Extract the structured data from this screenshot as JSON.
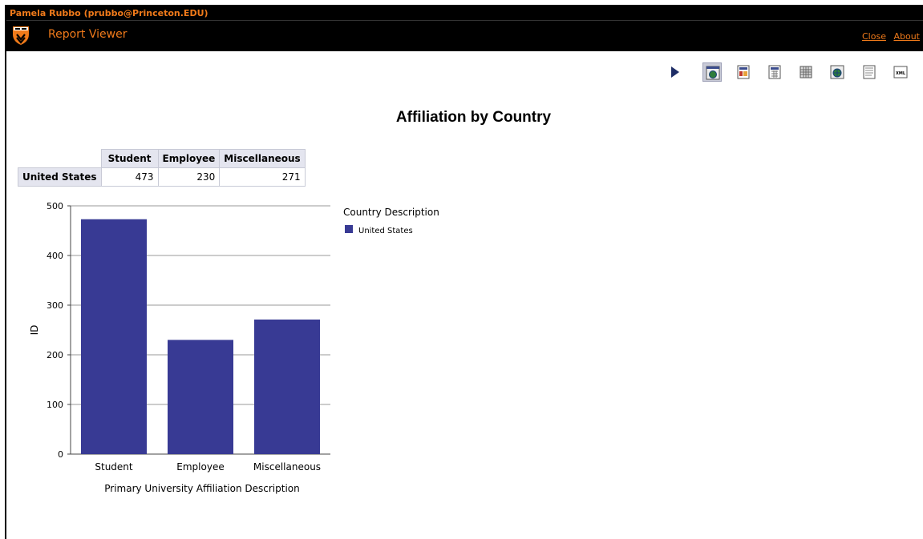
{
  "user": {
    "label": "Pamela Rubbo (prubbo@Princeton.EDU)"
  },
  "app": {
    "title": "Report Viewer"
  },
  "links": {
    "close": "Close",
    "about": "About"
  },
  "toolbar": {
    "buttons": [
      {
        "name": "run-report-button",
        "icon": "play-icon"
      },
      {
        "name": "view-html-button",
        "icon": "web-icon",
        "selected": true
      },
      {
        "name": "view-pdf-button",
        "icon": "pdf-icon"
      },
      {
        "name": "view-excel-button",
        "icon": "excel-icon"
      },
      {
        "name": "view-csv-button",
        "icon": "grid-icon"
      },
      {
        "name": "view-web-archive-button",
        "icon": "globe-icon"
      },
      {
        "name": "view-text-button",
        "icon": "text-icon"
      },
      {
        "name": "view-xml-button",
        "icon": "xml-icon",
        "label": "XML"
      }
    ]
  },
  "report": {
    "title": "Affiliation by Country"
  },
  "crosstab": {
    "columns": [
      "Student",
      "Employee",
      "Miscellaneous"
    ],
    "rows": [
      {
        "label": "United States",
        "values": [
          "473",
          "230",
          "271"
        ]
      }
    ]
  },
  "chart_data": {
    "type": "bar",
    "categories": [
      "Student",
      "Employee",
      "Miscellaneous"
    ],
    "series": [
      {
        "name": "United States",
        "values": [
          473,
          230,
          271
        ],
        "color": "#383a94"
      }
    ],
    "xlabel": "Primary University Affiliation Description",
    "ylabel": "ID",
    "ylim": [
      0,
      500
    ],
    "yticks": [
      0,
      100,
      200,
      300,
      400,
      500
    ],
    "grid": true,
    "legend": {
      "title": "Country Description",
      "placement": "right"
    }
  },
  "colors": {
    "accent": "#f07a1a",
    "bar": "#383a94",
    "header_bg": "#e4e5ef"
  }
}
